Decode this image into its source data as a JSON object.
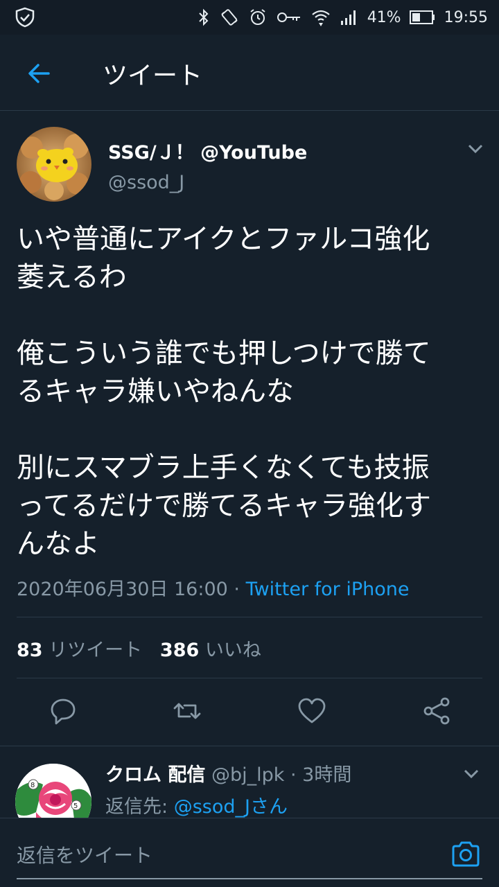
{
  "status_bar": {
    "battery": "41%",
    "time": "19:55",
    "icons": [
      "shield-check-icon",
      "bluetooth-icon",
      "vibrate-icon",
      "alarm-icon",
      "key-icon",
      "wifi-icon",
      "signal-icon",
      "battery-icon"
    ]
  },
  "header": {
    "title": "ツイート",
    "back_icon": "arrow-left-icon"
  },
  "tweet": {
    "author_name": "SSG/Ｊ！ @YouTube",
    "author_handle": "@ssod_J",
    "paragraphs": [
      [
        "いや普通にアイクとファルコ強化",
        "萎えるわ"
      ],
      [
        "俺こういう誰でも押しつけで勝て",
        "るキャラ嫌いやねんな"
      ],
      [
        "別にスマブラ上手くなくても技振",
        "ってるだけで勝てるキャラ強化す",
        "んなよ"
      ]
    ],
    "timestamp": "2020年06月30日 16:00 · ",
    "source": "Twitter for iPhone",
    "retweet_count": "83",
    "retweet_label": " リツイート",
    "like_count": "386",
    "like_label": " いいね",
    "actions": [
      "reply-icon",
      "retweet-icon",
      "like-icon",
      "share-icon"
    ]
  },
  "reply": {
    "name": "クロム 配信",
    "meta": " @bj_lpk · 3時間",
    "reply_prefix": "返信先: ",
    "reply_to": "@ssod_Jさん"
  },
  "composer": {
    "placeholder": "返信をツイート"
  },
  "colors": {
    "background": "#15202b",
    "accent": "#1da1f2",
    "secondary_text": "#8899a6",
    "divider": "#2b3a48"
  }
}
